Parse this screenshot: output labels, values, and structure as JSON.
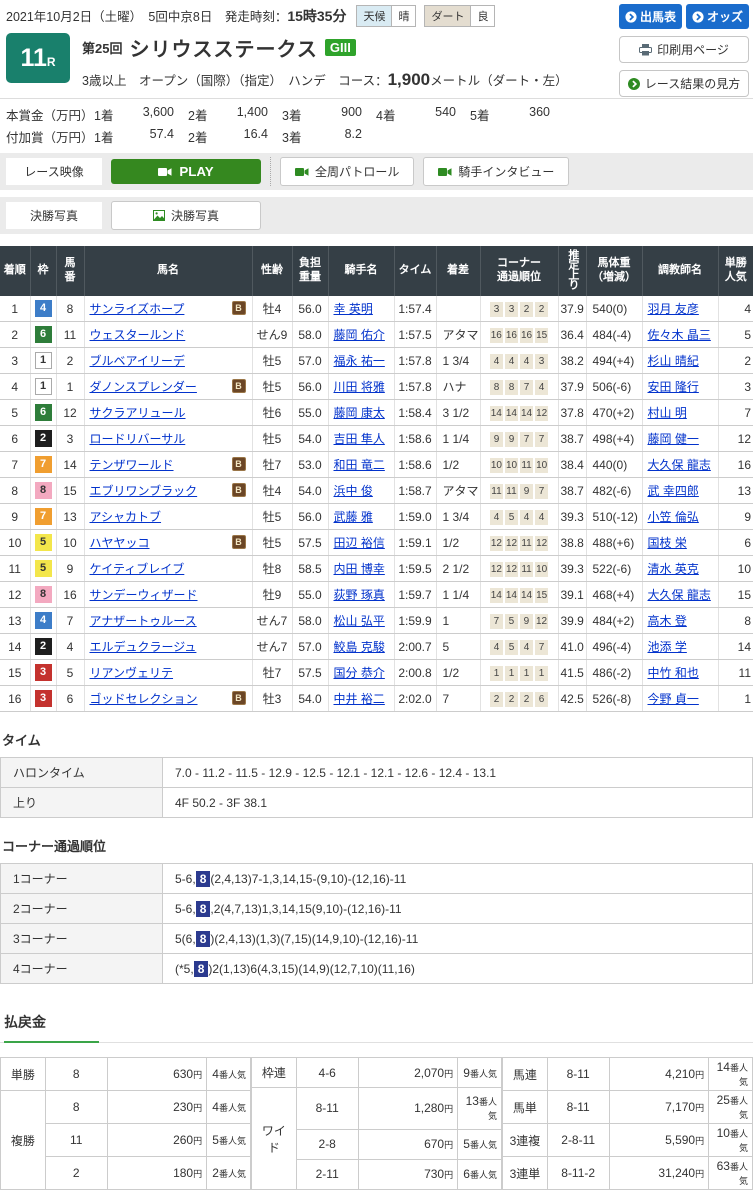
{
  "page": {
    "date_line": "2021年10月2日（土曜）　5回中京8日　発走時刻：",
    "start_time": "15時35分"
  },
  "weather": {
    "label1": "天候",
    "value1": "晴",
    "label2": "ダート",
    "value2": "良"
  },
  "top_buttons": {
    "entry": "出馬表",
    "odds": "オッズ",
    "print": "印刷用ページ",
    "guide": "レース結果の見方"
  },
  "race": {
    "number": "11",
    "r": "R",
    "ordinal": "第25回",
    "title": "シリウスステークス",
    "grade": "GIII",
    "conditions_pre": "3歳以上　オープン（国際）（指定）　ハンデ　コース：",
    "distance": "1,900",
    "conditions_post": "メートル（ダート・左）"
  },
  "prize": {
    "main_label": "本賞金（万円）",
    "added_label": "付加賞（万円）",
    "main": [
      [
        "1着",
        "3,600"
      ],
      [
        "2着",
        "1,400"
      ],
      [
        "3着",
        "900"
      ],
      [
        "4着",
        "540"
      ],
      [
        "5着",
        "360"
      ]
    ],
    "added": [
      [
        "1着",
        "57.4"
      ],
      [
        "2着",
        "16.4"
      ],
      [
        "3着",
        "8.2"
      ]
    ]
  },
  "media": {
    "video_label": "レース映像",
    "play": "PLAY",
    "patrol": "全周パトロール",
    "interview": "騎手インタビュー",
    "photo_label": "決勝写真",
    "photo_button": "決勝写真"
  },
  "results": {
    "headers": [
      "着順",
      "枠",
      "馬\n番",
      "馬名",
      "性齢",
      "負担\n重量",
      "騎手名",
      "タイム",
      "着差",
      "コーナー\n通過順位",
      "推定上り",
      "馬体重\n（増減）",
      "調教師名",
      "単勝\n人気"
    ],
    "rows": [
      {
        "pos": "1",
        "frame": "4",
        "num": "8",
        "horse": "サンライズホープ",
        "b": true,
        "sexage": "牡4",
        "carry": "56.0",
        "jockey": "幸 英明",
        "time": "1:57.4",
        "margin": "",
        "corners": [
          "3",
          "3",
          "2",
          "2"
        ],
        "up": "37.9",
        "weight": "540(0)",
        "trainer": "羽月 友彦",
        "pop": "4"
      },
      {
        "pos": "2",
        "frame": "6",
        "num": "11",
        "horse": "ウェスタールンド",
        "b": false,
        "sexage": "せん9",
        "carry": "58.0",
        "jockey": "藤岡 佑介",
        "time": "1:57.5",
        "margin": "アタマ",
        "corners": [
          "16",
          "16",
          "16",
          "15"
        ],
        "up": "36.4",
        "weight": "484(-4)",
        "trainer": "佐々木 晶三",
        "pop": "5"
      },
      {
        "pos": "3",
        "frame": "1",
        "num": "2",
        "horse": "ブルベアイリーデ",
        "b": false,
        "sexage": "牡5",
        "carry": "57.0",
        "jockey": "福永 祐一",
        "time": "1:57.8",
        "margin": "1 3/4",
        "corners": [
          "4",
          "4",
          "4",
          "3"
        ],
        "up": "38.2",
        "weight": "494(+4)",
        "trainer": "杉山 晴紀",
        "pop": "2"
      },
      {
        "pos": "4",
        "frame": "1",
        "num": "1",
        "horse": "ダノンスプレンダー",
        "b": true,
        "sexage": "牡5",
        "carry": "56.0",
        "jockey": "川田 将雅",
        "time": "1:57.8",
        "margin": "ハナ",
        "corners": [
          "8",
          "8",
          "7",
          "4"
        ],
        "up": "37.9",
        "weight": "506(-6)",
        "trainer": "安田 隆行",
        "pop": "3"
      },
      {
        "pos": "5",
        "frame": "6",
        "num": "12",
        "horse": "サクラアリュール",
        "b": false,
        "sexage": "牡6",
        "carry": "55.0",
        "jockey": "藤岡 康太",
        "time": "1:58.4",
        "margin": "3 1/2",
        "corners": [
          "14",
          "14",
          "14",
          "12"
        ],
        "up": "37.8",
        "weight": "470(+2)",
        "trainer": "村山 明",
        "pop": "7"
      },
      {
        "pos": "6",
        "frame": "2",
        "num": "3",
        "horse": "ロードリバーサル",
        "b": false,
        "sexage": "牡5",
        "carry": "54.0",
        "jockey": "吉田 隼人",
        "time": "1:58.6",
        "margin": "1 1/4",
        "corners": [
          "9",
          "9",
          "7",
          "7"
        ],
        "up": "38.7",
        "weight": "498(+4)",
        "trainer": "藤岡 健一",
        "pop": "12"
      },
      {
        "pos": "7",
        "frame": "7",
        "num": "14",
        "horse": "テンザワールド",
        "b": true,
        "sexage": "牡7",
        "carry": "53.0",
        "jockey": "和田 竜二",
        "time": "1:58.6",
        "margin": "1/2",
        "corners": [
          "10",
          "10",
          "11",
          "10"
        ],
        "up": "38.4",
        "weight": "440(0)",
        "trainer": "大久保 龍志",
        "pop": "16"
      },
      {
        "pos": "8",
        "frame": "8",
        "num": "15",
        "horse": "エブリワンブラック",
        "b": true,
        "sexage": "牡4",
        "carry": "54.0",
        "jockey": "浜中 俊",
        "time": "1:58.7",
        "margin": "アタマ",
        "corners": [
          "11",
          "11",
          "9",
          "7"
        ],
        "up": "38.7",
        "weight": "482(-6)",
        "trainer": "武 幸四郎",
        "pop": "13"
      },
      {
        "pos": "9",
        "frame": "7",
        "num": "13",
        "horse": "アシャカトブ",
        "b": false,
        "sexage": "牡5",
        "carry": "56.0",
        "jockey": "武藤 雅",
        "time": "1:59.0",
        "margin": "1 3/4",
        "corners": [
          "4",
          "5",
          "4",
          "4"
        ],
        "up": "39.3",
        "weight": "510(-12)",
        "trainer": "小笠 倫弘",
        "pop": "9"
      },
      {
        "pos": "10",
        "frame": "5",
        "num": "10",
        "horse": "ハヤヤッコ",
        "b": true,
        "sexage": "牡5",
        "carry": "57.5",
        "jockey": "田辺 裕信",
        "time": "1:59.1",
        "margin": "1/2",
        "corners": [
          "12",
          "12",
          "11",
          "12"
        ],
        "up": "38.8",
        "weight": "488(+6)",
        "trainer": "国枝 栄",
        "pop": "6"
      },
      {
        "pos": "11",
        "frame": "5",
        "num": "9",
        "horse": "ケイティブレイブ",
        "b": false,
        "sexage": "牡8",
        "carry": "58.5",
        "jockey": "内田 博幸",
        "time": "1:59.5",
        "margin": "2 1/2",
        "corners": [
          "12",
          "12",
          "11",
          "10"
        ],
        "up": "39.3",
        "weight": "522(-6)",
        "trainer": "清水 英克",
        "pop": "10"
      },
      {
        "pos": "12",
        "frame": "8",
        "num": "16",
        "horse": "サンデーウィザード",
        "b": false,
        "sexage": "牡9",
        "carry": "55.0",
        "jockey": "荻野 琢真",
        "time": "1:59.7",
        "margin": "1 1/4",
        "corners": [
          "14",
          "14",
          "14",
          "15"
        ],
        "up": "39.1",
        "weight": "468(+4)",
        "trainer": "大久保 龍志",
        "pop": "15"
      },
      {
        "pos": "13",
        "frame": "4",
        "num": "7",
        "horse": "アナザートゥルース",
        "b": false,
        "sexage": "せん7",
        "carry": "58.0",
        "jockey": "松山 弘平",
        "time": "1:59.9",
        "margin": "1",
        "corners": [
          "7",
          "5",
          "9",
          "12"
        ],
        "up": "39.9",
        "weight": "484(+2)",
        "trainer": "高木 登",
        "pop": "8"
      },
      {
        "pos": "14",
        "frame": "2",
        "num": "4",
        "horse": "エルデュクラージュ",
        "b": false,
        "sexage": "せん7",
        "carry": "57.0",
        "jockey": "鮫島 克駿",
        "time": "2:00.7",
        "margin": "5",
        "corners": [
          "4",
          "5",
          "4",
          "7"
        ],
        "up": "41.0",
        "weight": "496(-4)",
        "trainer": "池添 学",
        "pop": "14"
      },
      {
        "pos": "15",
        "frame": "3",
        "num": "5",
        "horse": "リアンヴェリテ",
        "b": false,
        "sexage": "牡7",
        "carry": "57.5",
        "jockey": "国分 恭介",
        "time": "2:00.8",
        "margin": "1/2",
        "corners": [
          "1",
          "1",
          "1",
          "1"
        ],
        "up": "41.5",
        "weight": "486(-2)",
        "trainer": "中竹 和也",
        "pop": "11"
      },
      {
        "pos": "16",
        "frame": "3",
        "num": "6",
        "horse": "ゴッドセレクション",
        "b": true,
        "sexage": "牡3",
        "carry": "54.0",
        "jockey": "中井 裕二",
        "time": "2:02.0",
        "margin": "7",
        "corners": [
          "2",
          "2",
          "2",
          "6"
        ],
        "up": "42.5",
        "weight": "526(-8)",
        "trainer": "今野 貞一",
        "pop": "1"
      }
    ]
  },
  "time_section": {
    "heading": "タイム",
    "rows": [
      [
        "ハロンタイム",
        "7.0 - 11.2 - 11.5 - 12.9 - 12.5 - 12.1 - 12.1 - 12.6 - 12.4 - 13.1"
      ],
      [
        "上り",
        "4F 50.2 - 3F 38.1"
      ]
    ]
  },
  "corner_section": {
    "heading": "コーナー通過順位",
    "highlight": "8",
    "rows": [
      {
        "label": "1コーナー",
        "pre": "5-6,",
        "post": "(2,4,13)7-1,3,14,15-(9,10)-(12,16)-11"
      },
      {
        "label": "2コーナー",
        "pre": "5-6,",
        "post": ",2(4,7,13)1,3,14,15(9,10)-(12,16)-11"
      },
      {
        "label": "3コーナー",
        "pre": "5(6,",
        "post": ")(2,4,13)(1,3)(7,15)(14,9,10)-(12,16)-11"
      },
      {
        "label": "4コーナー",
        "pre": "(*5,",
        "post": ")2(1,13)6(4,3,15)(14,9)(12,7,10)(11,16)"
      }
    ]
  },
  "payout": {
    "heading": "払戻金",
    "yen_suffix": "円",
    "pop_suffix": "番人気",
    "groups": [
      [
        {
          "label": "単勝",
          "rows": [
            [
              "8",
              "630",
              "4"
            ]
          ]
        },
        {
          "label": "複勝",
          "rows": [
            [
              "8",
              "230",
              "4"
            ],
            [
              "11",
              "260",
              "5"
            ],
            [
              "2",
              "180",
              "2"
            ]
          ]
        }
      ],
      [
        {
          "label": "枠連",
          "rows": [
            [
              "4-6",
              "2,070",
              "9"
            ]
          ]
        },
        {
          "label": "ワイド",
          "rows": [
            [
              "8-11",
              "1,280",
              "13"
            ],
            [
              "2-8",
              "670",
              "5"
            ],
            [
              "2-11",
              "730",
              "6"
            ]
          ]
        }
      ],
      [
        {
          "label": "馬連",
          "rows": [
            [
              "8-11",
              "4,210",
              "14"
            ]
          ]
        },
        {
          "label": "馬単",
          "rows": [
            [
              "8-11",
              "7,170",
              "25"
            ]
          ]
        },
        {
          "label": "3連複",
          "rows": [
            [
              "2-8-11",
              "5,590",
              "10"
            ]
          ]
        },
        {
          "label": "3連単",
          "rows": [
            [
              "8-11-2",
              "31,240",
              "63"
            ]
          ]
        }
      ]
    ]
  },
  "colors": {
    "accent_blue": "#1a6ccc",
    "accent_green": "#35881f",
    "race_no_teal": "#19806c",
    "grade_green": "#2fa32b",
    "header_slate": "#353f46",
    "highlight_navy": "#2b3a8f"
  }
}
